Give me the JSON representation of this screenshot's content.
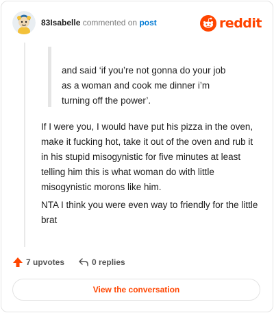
{
  "header": {
    "username": "83Isabelle",
    "commented_on": "commented on",
    "post_link": "post",
    "brand": "reddit"
  },
  "comment": {
    "quote": [
      "and said ‘if you’re not gonna do your job",
      "as a woman and cook me dinner i’m",
      "turning off the power’."
    ],
    "paragraph1": "If I were you, I would have put his pizza in the oven, make it fucking hot, take it out of the oven and rub it in his stupid misogynistic for five minutes at least telling him this is what woman do with little misogynistic morons like him.",
    "paragraph2": "NTA I think you were even way to friendly for the little brat"
  },
  "actions": {
    "upvotes": "7 upvotes",
    "replies": "0 replies",
    "view_conversation": "View the conversation"
  },
  "colors": {
    "brand": "#ff4500",
    "link": "#0079d3"
  }
}
